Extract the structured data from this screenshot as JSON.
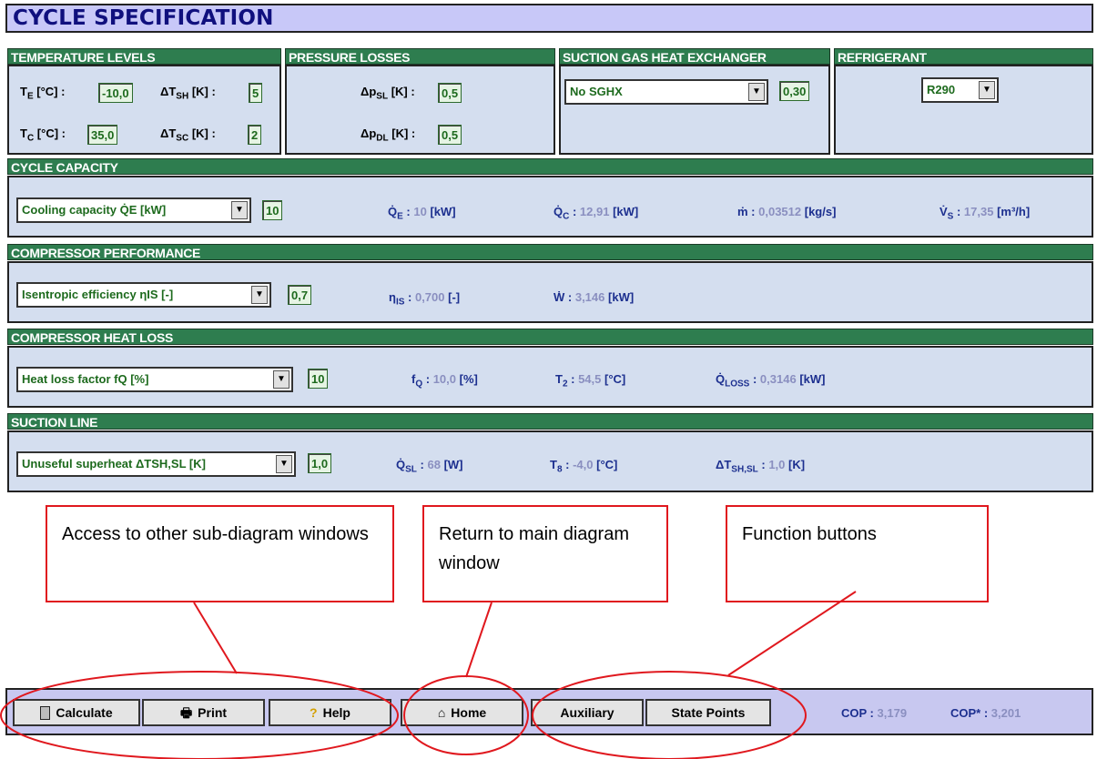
{
  "title": "CYCLE SPECIFICATION",
  "temperature_levels": {
    "header": "TEMPERATURE LEVELS",
    "te_label": "T",
    "te_sub": "E",
    "te_unit": " [°C] :",
    "te_value": "-10,0",
    "tsh_label": "ΔT",
    "tsh_sub": "SH",
    "tsh_unit": " [K] :",
    "tsh_value": "5",
    "tc_label": "T",
    "tc_sub": "C",
    "tc_unit": " [°C] :",
    "tc_value": "35,0",
    "tsc_label": "ΔT",
    "tsc_sub": "SC",
    "tsc_unit": " [K] :",
    "tsc_value": "2"
  },
  "pressure_losses": {
    "header": "PRESSURE LOSSES",
    "psl_label": "Δp",
    "psl_sub": "SL",
    "psl_unit": " [K] :",
    "psl_value": "0,5",
    "pdl_label": "Δp",
    "pdl_sub": "DL",
    "pdl_unit": " [K] :",
    "pdl_value": "0,5"
  },
  "sghx": {
    "header": "SUCTION GAS HEAT EXCHANGER",
    "selected": "No SGHX",
    "value": "0,30"
  },
  "refrigerant": {
    "header": "REFRIGERANT",
    "selected": "R290"
  },
  "cycle_capacity": {
    "header": "CYCLE CAPACITY",
    "selected": "Cooling capacity Q̇E [kW]",
    "input": "10",
    "qe_label": "Q̇",
    "qe_sub": "E",
    "qe_value": "10",
    "qe_unit": "[kW]",
    "qc_label": "Q̇",
    "qc_sub": "C",
    "qc_value": "12,91",
    "qc_unit": "[kW]",
    "m_label": "ṁ :",
    "m_value": "0,03512",
    "m_unit": "[kg/s]",
    "vs_label": "V̇",
    "vs_sub": "S",
    "vs_value": "17,35",
    "vs_unit": "[m³/h]"
  },
  "compressor_performance": {
    "header": "COMPRESSOR PERFORMANCE",
    "selected": "Isentropic efficiency ηIS [-]",
    "input": "0,7",
    "eta_label": "η",
    "eta_sub": "IS",
    "eta_value": "0,700",
    "eta_unit": "[-]",
    "w_label": "Ẇ :",
    "w_value": "3,146",
    "w_unit": "[kW]"
  },
  "compressor_heat_loss": {
    "header": "COMPRESSOR HEAT LOSS",
    "selected": "Heat loss factor fQ [%]",
    "input": "10",
    "fq_label": "f",
    "fq_sub": "Q",
    "fq_value": "10,0",
    "fq_unit": "[%]",
    "t2_label": "T",
    "t2_sub": "2",
    "t2_value": "54,5",
    "t2_unit": "[°C]",
    "ql_label": "Q̇",
    "ql_sub": "LOSS",
    "ql_value": "0,3146",
    "ql_unit": "[kW]"
  },
  "suction_line": {
    "header": "SUCTION LINE",
    "selected": "Unuseful superheat ΔTSH,SL [K]",
    "input": "1,0",
    "qsl_label": "Q̇",
    "qsl_sub": "SL",
    "qsl_value": "68",
    "qsl_unit": "[W]",
    "t8_label": "T",
    "t8_sub": "8",
    "t8_value": "-4,0",
    "t8_unit": "[°C]",
    "dt_label": "ΔT",
    "dt_sub": "SH,SL",
    "dt_value": "1,0",
    "dt_unit": "[K]"
  },
  "buttons": {
    "calculate": "Calculate",
    "print": "Print",
    "help": "Help",
    "home": "Home",
    "auxiliary": "Auxiliary",
    "state_points": "State Points"
  },
  "cop": {
    "cop_label": "COP :",
    "cop_value": "3,179",
    "cops_label": "COP* :",
    "cops_value": "3,201"
  },
  "callouts": {
    "sub_diagram": "Access to other sub-diagram windows",
    "main_diagram": "Return to main diagram window",
    "function": "Function buttons"
  },
  "colors": {
    "header_green": "#2e7d4f",
    "title_blue": "#10107e",
    "annotation_red": "#e0181e"
  }
}
